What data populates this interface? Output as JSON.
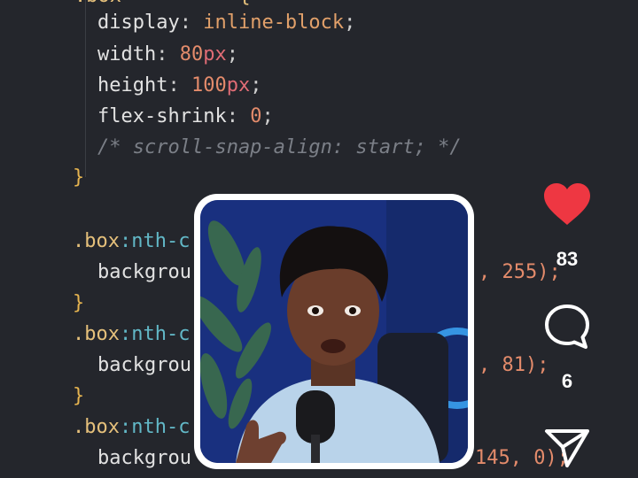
{
  "code_lines": [
    {
      "kind": "decl",
      "prop": "display",
      "value": "inline-block"
    },
    {
      "kind": "decl_unit",
      "prop": "width",
      "num": "80",
      "unit": "px"
    },
    {
      "kind": "decl_unit",
      "prop": "height",
      "num": "100",
      "unit": "px"
    },
    {
      "kind": "decl_num",
      "prop": "flex-shrink",
      "num": "0"
    },
    {
      "kind": "comment",
      "text": "/* scroll-snap-align: start; */"
    },
    {
      "kind": "brace",
      "text": "}"
    },
    {
      "kind": "selector",
      "text": ".box",
      "pseudo": ":nth-c"
    },
    {
      "kind": "decl_tail",
      "prop": "backgrou",
      "tail": ", 255);"
    },
    {
      "kind": "brace",
      "text": "}"
    },
    {
      "kind": "selector",
      "text": ".box",
      "pseudo": ":nth-c"
    },
    {
      "kind": "decl_tail",
      "prop": "backgrou",
      "tail": ", 81);"
    },
    {
      "kind": "brace",
      "text": "}"
    },
    {
      "kind": "selector",
      "text": ".box",
      "pseudo": ":nth-c"
    },
    {
      "kind": "decl_tail",
      "prop": "backgrou",
      "tail": "145, 0);"
    }
  ],
  "video": {
    "description_icon": "presenter-video"
  },
  "actions": {
    "like_count": "83",
    "comment_count": "6",
    "like_color": "#ee3742"
  }
}
